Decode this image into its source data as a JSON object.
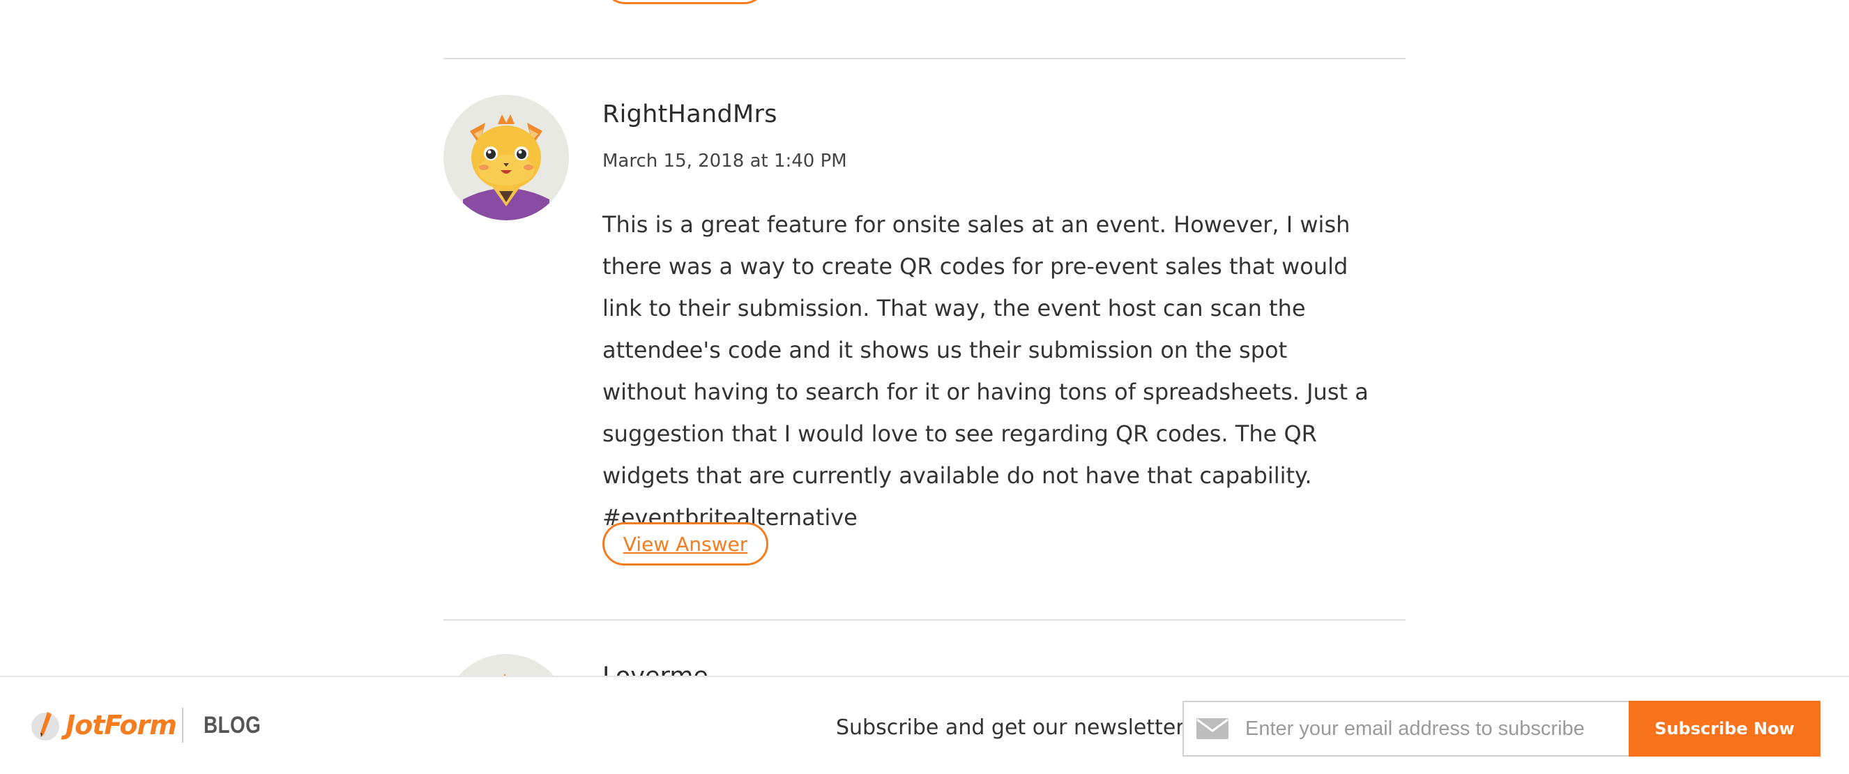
{
  "comment": {
    "author": "RightHandMrs",
    "date": "March 15, 2018 at 1:40 PM",
    "body": "This is a great feature for onsite sales at an event. However, I wish there was a way to create QR codes for pre-event sales that would link to their submission. That way, the event host can scan the attendee's code and it shows us their submission on the spot without having to search for it or having tons of spreadsheets. Just a suggestion that I would love to see regarding QR codes. The QR widgets that are currently available do not have that capability. #eventbritealternative",
    "answer_button": "View Answer",
    "avatar_icon": "cat-avatar-icon"
  },
  "next_comment": {
    "author": "Loverme"
  },
  "footer": {
    "logo_text": "JotForm",
    "blog_label": "BLOG",
    "newsletter_text": "Subscribe and get our newsletter!",
    "email_placeholder": "Enter your email address to subscribe",
    "email_icon": "mail-icon",
    "subscribe_label": "Subscribe Now"
  },
  "colors": {
    "accent": "#f57c1f",
    "subscribe_bg": "#f8711b",
    "divider": "#dddddd"
  }
}
